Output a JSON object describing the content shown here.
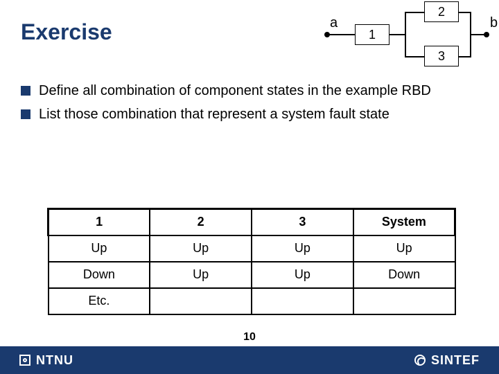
{
  "title": "Exercise",
  "rbd": {
    "a": "a",
    "b": "b",
    "c1": "1",
    "c2": "2",
    "c3": "3"
  },
  "bullets": [
    "Define all combination of component states in the example RBD",
    "List those combination that represent a system fault state"
  ],
  "table": {
    "headers": [
      "1",
      "2",
      "3",
      "System"
    ],
    "rows": [
      [
        "Up",
        "Up",
        "Up",
        "Up"
      ],
      [
        "Down",
        "Up",
        "Up",
        "Down"
      ],
      [
        "Etc.",
        "",
        "",
        ""
      ]
    ]
  },
  "page_number": "10",
  "footer": {
    "left": "NTNU",
    "right": "SINTEF"
  }
}
